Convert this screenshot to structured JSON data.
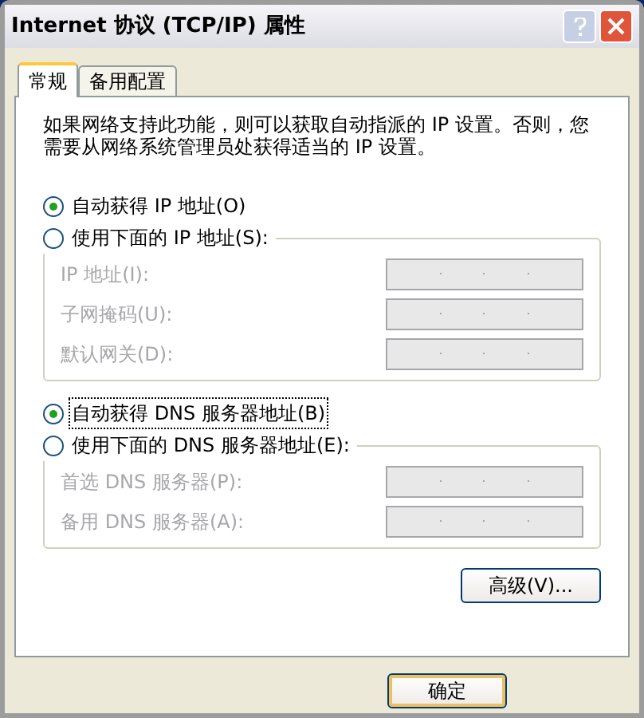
{
  "window": {
    "title": "Internet 协议 (TCP/IP) 属性"
  },
  "tabs": [
    {
      "label": "常规",
      "selected": true
    },
    {
      "label": "备用配置",
      "selected": false
    }
  ],
  "description": "如果网络支持此功能，则可以获取自动指派的 IP 设置。否则，您需要从网络系统管理员处获得适当的 IP 设置。",
  "ip_options": [
    {
      "label": "自动获得 IP 地址(O)",
      "selected": true,
      "focused": false
    },
    {
      "label": "使用下面的 IP 地址(S):",
      "selected": false,
      "focused": false
    }
  ],
  "ip_fields": [
    {
      "label": "IP 地址(I):",
      "disabled": true
    },
    {
      "label": "子网掩码(U):",
      "disabled": true
    },
    {
      "label": "默认网关(D):",
      "disabled": true
    }
  ],
  "dns_options": [
    {
      "label": "自动获得 DNS 服务器地址(B)",
      "selected": true,
      "focused": true
    },
    {
      "label": "使用下面的 DNS 服务器地址(E):",
      "selected": false,
      "focused": false
    }
  ],
  "dns_fields": [
    {
      "label": "首选 DNS 服务器(P):",
      "disabled": true
    },
    {
      "label": "备用 DNS 服务器(A):",
      "disabled": true
    }
  ],
  "advanced_button": "高级(V)...",
  "ok_button": "确定"
}
